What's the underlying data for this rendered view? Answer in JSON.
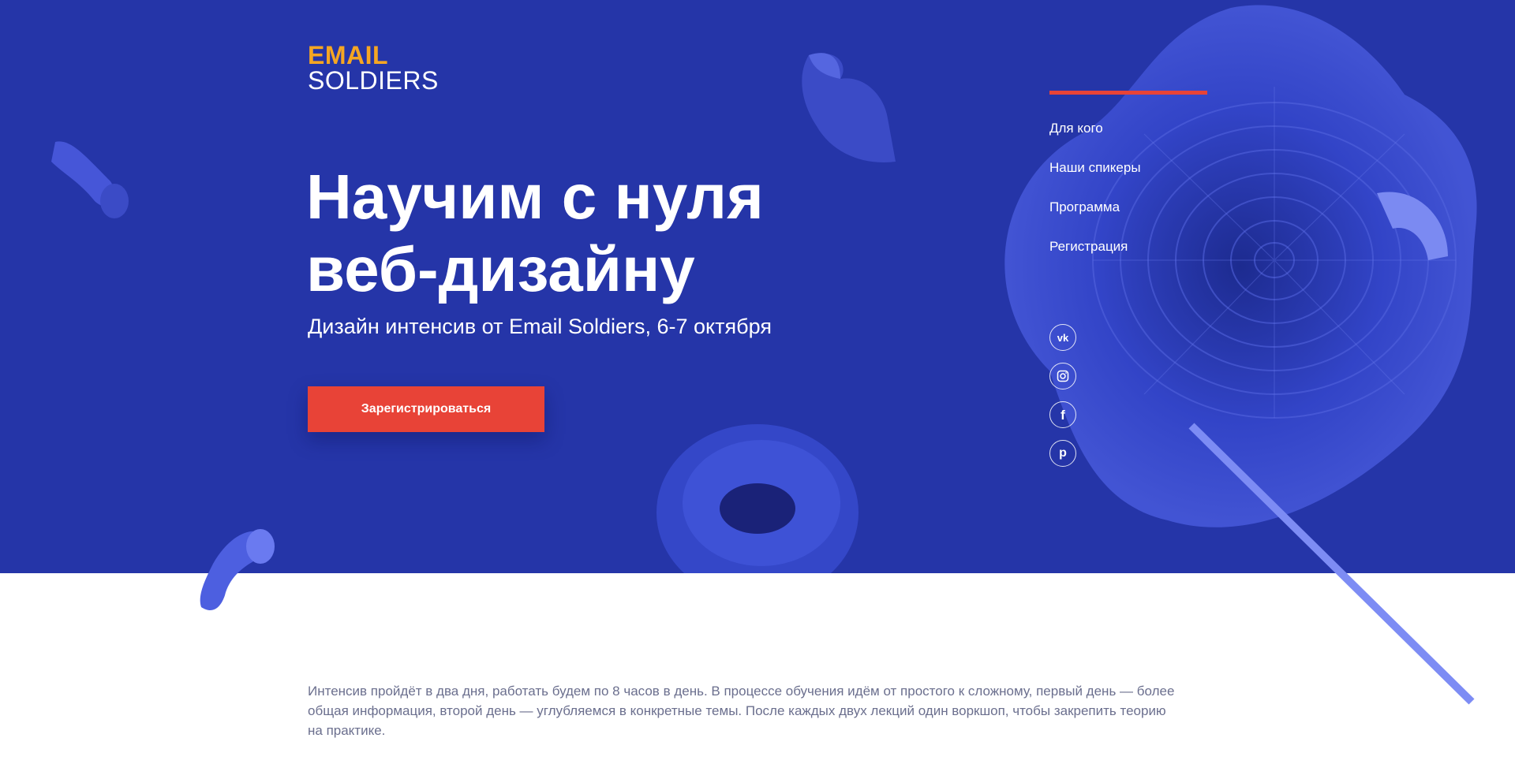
{
  "logo": {
    "line1": "EMAIL",
    "line2": "SOLDIERS"
  },
  "hero": {
    "title_line1": "Научим с нуля",
    "title_line2": "веб-дизайну",
    "subtitle": "Дизайн интенсив от Email Soldiers, 6-7 октября",
    "cta_label": "Зарегистрироваться"
  },
  "nav": {
    "items": [
      {
        "label": "Для кого"
      },
      {
        "label": "Наши спикеры"
      },
      {
        "label": "Программа"
      },
      {
        "label": "Регистрация"
      }
    ]
  },
  "socials": [
    {
      "icon": "vk-icon",
      "glyph": "vk"
    },
    {
      "icon": "instagram-icon",
      "glyph": ""
    },
    {
      "icon": "facebook-icon",
      "glyph": "f"
    },
    {
      "icon": "pinterest-icon",
      "glyph": "p"
    }
  ],
  "description": "Интенсив пройдёт в два дня, работать будем по 8 часов в день. В процессе обучения идём от простого к сложному, первый день — более общая информация, второй день — углубляемся в конкретные темы. После каждых двух лекций один воркшоп, чтобы закрепить теорию на практике.",
  "colors": {
    "hero_bg": "#2535a8",
    "accent_red": "#e84337",
    "logo_orange": "#f5a623",
    "body_text": "#6b6f8e"
  }
}
